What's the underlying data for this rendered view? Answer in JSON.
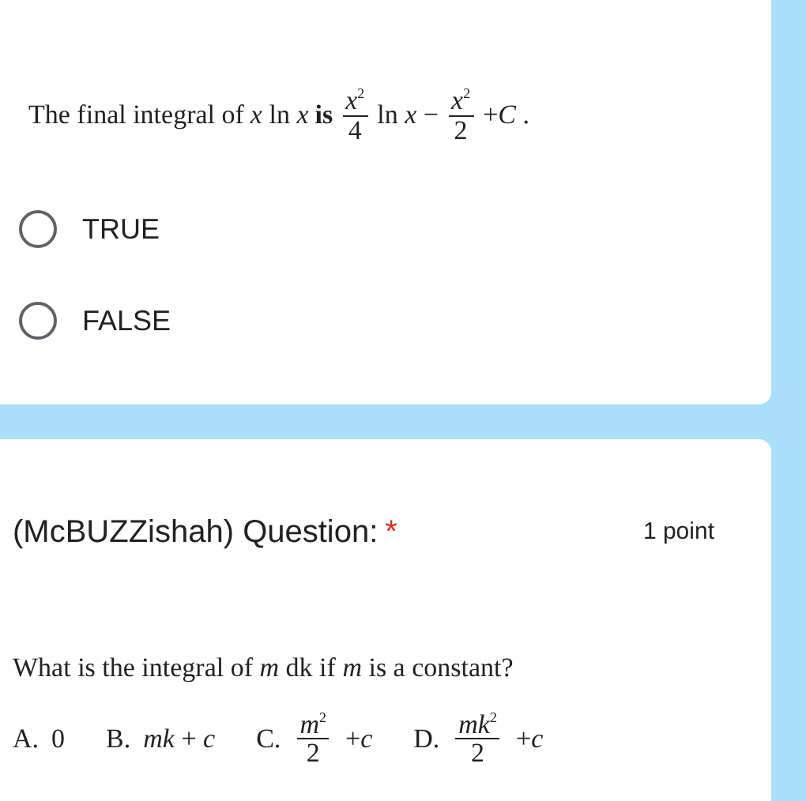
{
  "question_1": {
    "statement": [
      {
        "kind": "text",
        "text": "The final integral of"
      },
      {
        "kind": "math",
        "text": "*x* ln *x*"
      },
      {
        "kind": "bold",
        "text": "is"
      },
      {
        "kind": "frac",
        "numerator": "*x*$^{2}$",
        "denominator": "4"
      },
      {
        "kind": "math",
        "text": "ln *x* −"
      },
      {
        "kind": "frac",
        "numerator": "*x*$^{2}$",
        "denominator": "2"
      },
      {
        "kind": "math",
        "text": "+*C* ."
      }
    ],
    "options": [
      {
        "label": "TRUE",
        "selected": false
      },
      {
        "label": "FALSE",
        "selected": false
      }
    ]
  },
  "question_2": {
    "title": "(McBUZZishah) Question:",
    "required_mark": "*",
    "points": "1 point",
    "text": "What is the integral of *m* dk if *m* is a constant?",
    "choices": [
      {
        "letter": "A.",
        "parts": [
          {
            "kind": "math",
            "text": "0"
          }
        ]
      },
      {
        "letter": "B.",
        "parts": [
          {
            "kind": "math",
            "text": "*mk* + *c*"
          }
        ]
      },
      {
        "letter": "C.",
        "parts": [
          {
            "kind": "frac",
            "numerator": "*m*$^{2}$",
            "denominator": "2"
          },
          {
            "kind": "math",
            "text": "+*c*"
          }
        ]
      },
      {
        "letter": "D.",
        "parts": [
          {
            "kind": "frac",
            "numerator": "*mk*$^{2}$",
            "denominator": "2"
          },
          {
            "kind": "math",
            "text": "+*c*"
          }
        ]
      }
    ]
  }
}
